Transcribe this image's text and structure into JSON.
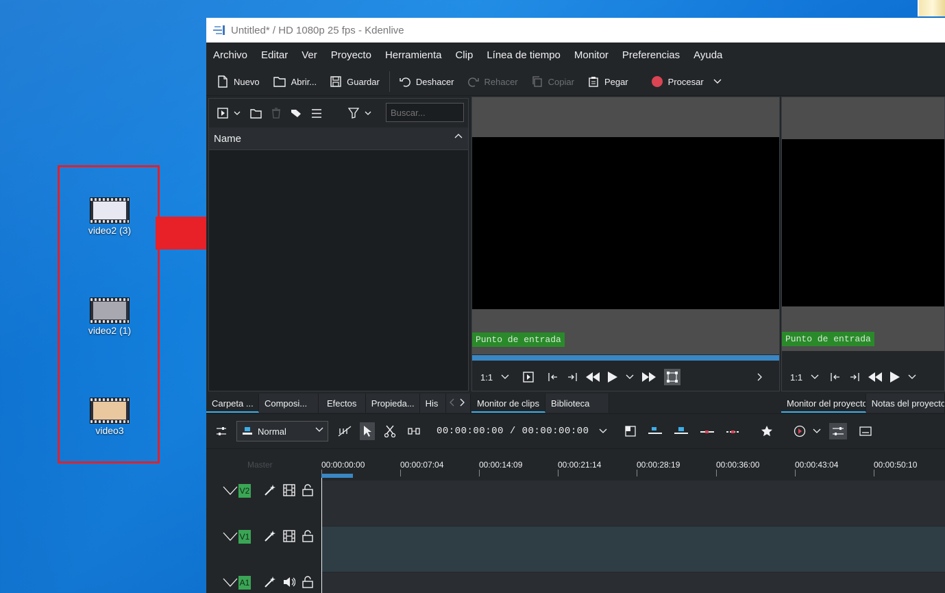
{
  "window": {
    "title": "Untitled* / HD 1080p 25 fps - Kdenlive"
  },
  "menu": [
    "Archivo",
    "Editar",
    "Ver",
    "Proyecto",
    "Herramienta",
    "Clip",
    "Línea de tiempo",
    "Monitor",
    "Preferencias",
    "Ayuda"
  ],
  "toolbar": {
    "nuevo": "Nuevo",
    "abrir": "Abrir...",
    "guardar": "Guardar",
    "deshacer": "Deshacer",
    "rehacer": "Rehacer",
    "copiar": "Copiar",
    "pegar": "Pegar",
    "procesar": "Procesar"
  },
  "bin": {
    "search_placeholder": "Buscar...",
    "column_name": "Name"
  },
  "desktop": {
    "icons": [
      {
        "label": "video2 (3)"
      },
      {
        "label": "video2 (1)"
      },
      {
        "label": "video3"
      }
    ]
  },
  "clip_monitor": {
    "label": "Punto de entrada",
    "zoom": "1:1"
  },
  "project_monitor": {
    "label": "Punto de entrada",
    "zoom": "1:1"
  },
  "left_tabs": [
    "Carpeta ...",
    "Composi...",
    "Efectos",
    "Propieda...",
    "His"
  ],
  "mid_tabs": [
    "Monitor de clips",
    "Biblioteca"
  ],
  "right_tabs": [
    "Monitor del proyecto",
    "Notas del proyecto"
  ],
  "timeline": {
    "mode": "Normal",
    "timecode": "00:00:00:00 / 00:00:00:00",
    "master_label": "Master",
    "ruler": [
      "00:00:00:00",
      "00:00:07:04",
      "00:00:14:09",
      "00:00:21:14",
      "00:00:28:19",
      "00:00:36:00",
      "00:00:43:04",
      "00:00:50:10"
    ],
    "tracks": [
      {
        "name": "V2",
        "kind": "video"
      },
      {
        "name": "V1",
        "kind": "video"
      },
      {
        "name": "A1",
        "kind": "audio"
      }
    ]
  },
  "colors": {
    "accent": "#3daee9",
    "record": "#da4453",
    "marker_label": "#2a8a2a",
    "selection_box": "#e2202a",
    "arrow": "#e82028"
  }
}
